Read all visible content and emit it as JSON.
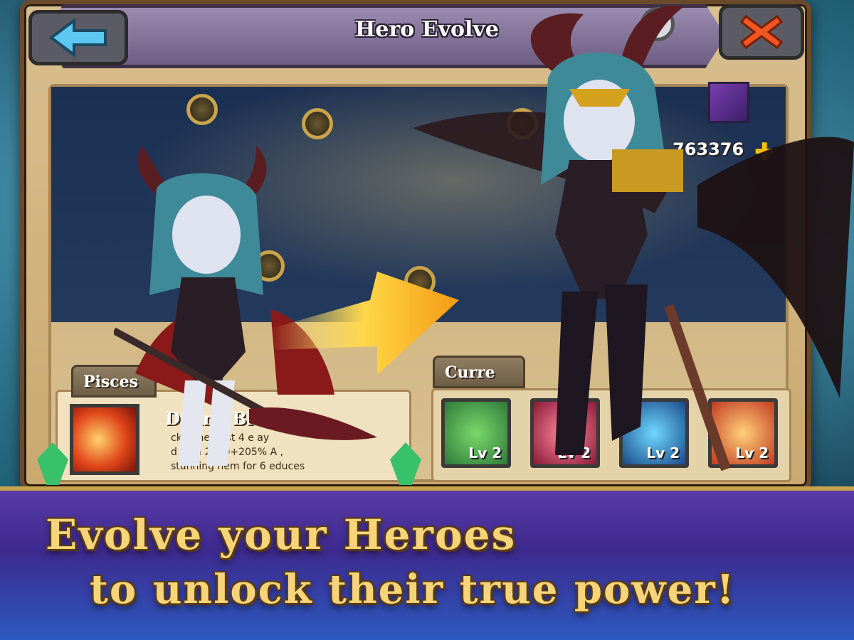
{
  "window": {
    "title": "Hero Evolve"
  },
  "resource": {
    "value": "763376",
    "icon": "potion-icon"
  },
  "left_panel": {
    "tab_label": "Pisces",
    "skill_name": "Divine Bl",
    "skill_desc": "cks t nearest 4 e ay\nd deal 2500+205% A ,\nstunning hem for 6 educes"
  },
  "right_panel": {
    "tab_label": "Curre",
    "slots": [
      {
        "label": "Lv 2",
        "icon": "heal-cross-icon"
      },
      {
        "label": "Lv 2",
        "icon": "slash-icon"
      },
      {
        "label": "Lv 2",
        "icon": "ice-icon"
      },
      {
        "label": "Lv 2",
        "icon": "fire-icon"
      }
    ]
  },
  "banner": {
    "line1": "Evolve your Heroes",
    "line2": "to unlock their true power!"
  },
  "colors": {
    "banner_text": "#f6d57a",
    "frame": "#6b4a2c",
    "banner_bg": "#3d2a8e"
  }
}
